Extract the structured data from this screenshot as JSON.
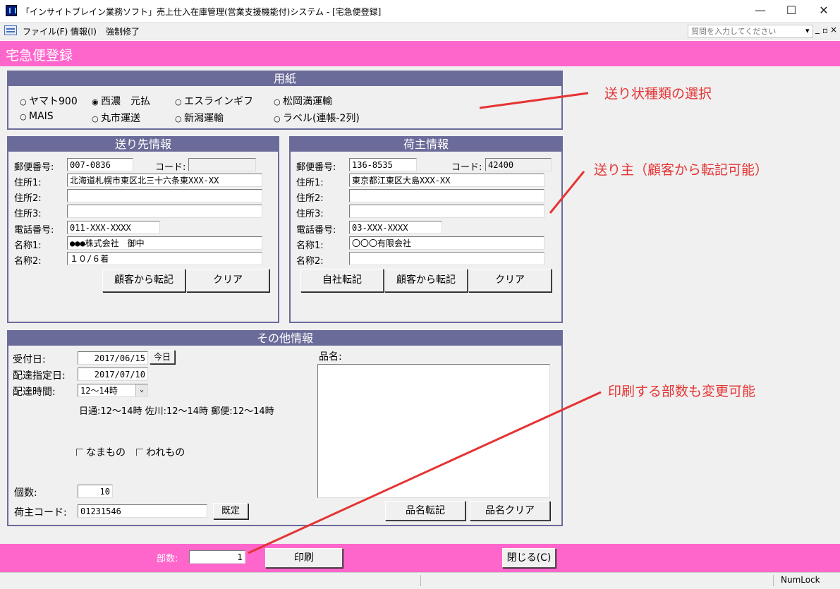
{
  "window": {
    "title": "「インサイトブレイン業務ソフト」売上仕入在庫管理(営業支援機能付)システム - [宅急便登録]",
    "minimize": "—",
    "maximize": "☐",
    "close": "✕"
  },
  "menu": {
    "items": [
      "ファイル(F)",
      "情報(I)",
      "強制修了"
    ],
    "help_placeholder": "質問を入力してください",
    "right_controls": [
      "▾",
      "_",
      "▫",
      "×"
    ]
  },
  "form": {
    "title": "宅急便登録"
  },
  "paper": {
    "heading": "用紙",
    "options": [
      {
        "label": "ヤマト900",
        "selected": false
      },
      {
        "label": "西濃　元払",
        "selected": true
      },
      {
        "label": "エスラインギフ",
        "selected": false
      },
      {
        "label": "松岡満運輸",
        "selected": false
      },
      {
        "label": "MAIS",
        "selected": false
      },
      {
        "label": "丸市運送",
        "selected": false
      },
      {
        "label": "新潟運輸",
        "selected": false
      },
      {
        "label": "ラベル(連帳-2列)",
        "selected": false
      }
    ]
  },
  "recipient": {
    "heading": "送り先情報",
    "postal_label": "郵便番号:",
    "postal": "007-0836",
    "code_label": "コード:",
    "code": "",
    "addr1_label": "住所1:",
    "addr1": "北海道札幌市東区北三十六条東XXX-XX",
    "addr2_label": "住所2:",
    "addr2": "",
    "addr3_label": "住所3:",
    "addr3": "",
    "phone_label": "電話番号:",
    "phone": "011-XXX-XXXX",
    "name1_label": "名称1:",
    "name1": "●●●株式会社　御中",
    "name2_label": "名称2:",
    "name2": "１０/６着",
    "copy_button": "顧客から転記",
    "clear_button": "クリア"
  },
  "shipper": {
    "heading": "荷主情報",
    "postal_label": "郵便番号:",
    "postal": "136-8535",
    "code_label": "コード:",
    "code": "42400",
    "addr1_label": "住所1:",
    "addr1": "東京都江東区大島XXX-XX",
    "addr2_label": "住所2:",
    "addr2": "",
    "addr3_label": "住所3:",
    "addr3": "",
    "phone_label": "電話番号:",
    "phone": "03-XXX-XXXX",
    "name1_label": "名称1:",
    "name1": "〇〇〇有限会社",
    "name2_label": "名称2:",
    "name2": "",
    "own_copy_button": "自社転記",
    "copy_button": "顧客から転記",
    "clear_button": "クリア"
  },
  "other": {
    "heading": "その他情報",
    "received_label": "受付日:",
    "received": "2017/06/15",
    "today_button": "今日",
    "delivery_date_label": "配達指定日:",
    "delivery_date": "2017/07/10",
    "delivery_time_label": "配達時間:",
    "delivery_time": "12～14時",
    "time_note": "日通:12～14時  佐川:12～14時  郵便:12～14時",
    "perishable_label": "なまもの",
    "fragile_label": "われもの",
    "count_label": "個数:",
    "count": "10",
    "shipper_code_label": "荷主コード:",
    "shipper_code": "01231546",
    "default_button": "既定",
    "item_name_label": "品名:",
    "item_name": "",
    "item_copy_button": "品名転記",
    "item_clear_button": "品名クリア"
  },
  "footer": {
    "copies_label": "部数:",
    "copies": "1",
    "print_button": "印刷",
    "close_button": "閉じる(C)"
  },
  "status": {
    "numlock": "NumLock"
  },
  "annotations": {
    "paper_note": "送り状種類の選択",
    "shipper_note": "送り主（顧客から転記可能）",
    "copies_note": "印刷する部数も変更可能",
    "color": "#e53434"
  }
}
